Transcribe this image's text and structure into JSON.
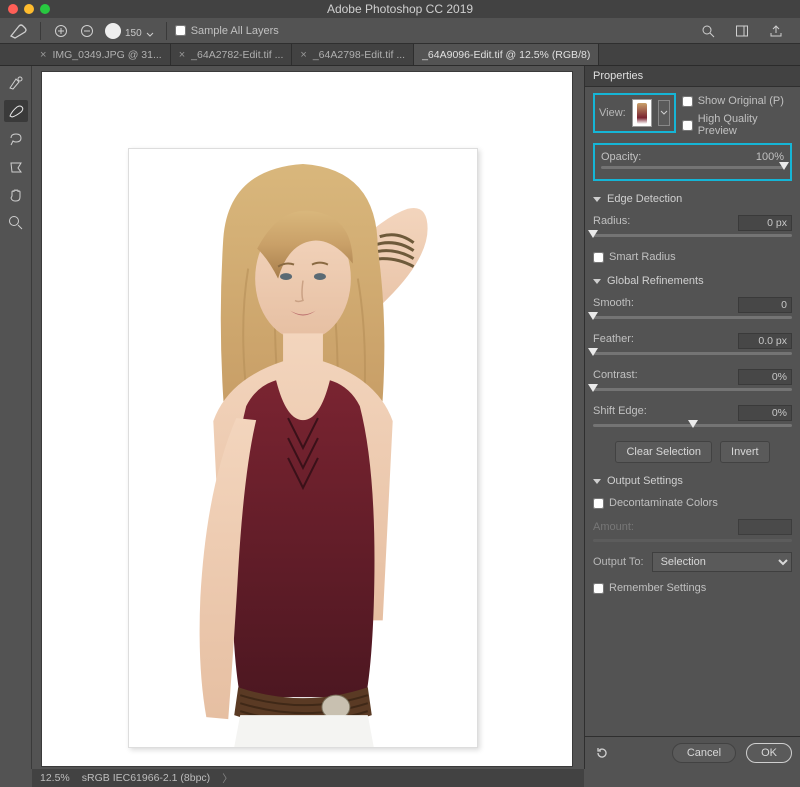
{
  "accent_color": "#15b5d6",
  "titlebar": {
    "title": "Adobe Photoshop CC 2019"
  },
  "optionsbar": {
    "brush_size": "150",
    "sample_all_layers_label": "Sample All Layers"
  },
  "tabs": [
    {
      "label": "IMG_0349.JPG @ 31...",
      "active": false
    },
    {
      "label": "_64A2782-Edit.tif ...",
      "active": false
    },
    {
      "label": "_64A2798-Edit.tif ...",
      "active": false
    },
    {
      "label": "_64A9096-Edit.tif @ 12.5% (RGB/8)",
      "active": true
    }
  ],
  "panel": {
    "header": "Properties",
    "view_label": "View:",
    "show_original_label": "Show Original (P)",
    "hq_preview_label": "High Quality Preview",
    "opacity_label": "Opacity:",
    "opacity_value": "100%",
    "sections": {
      "edge": {
        "title": "Edge Detection",
        "radius_label": "Radius:",
        "radius_value": "0 px",
        "smart_radius_label": "Smart Radius"
      },
      "refine": {
        "title": "Global Refinements",
        "smooth_label": "Smooth:",
        "smooth_value": "0",
        "feather_label": "Feather:",
        "feather_value": "0.0 px",
        "contrast_label": "Contrast:",
        "contrast_value": "0%",
        "shift_label": "Shift Edge:",
        "shift_value": "0%",
        "clear_btn": "Clear Selection",
        "invert_btn": "Invert"
      },
      "output": {
        "title": "Output Settings",
        "decon_label": "Decontaminate Colors",
        "amount_label": "Amount:",
        "output_to_label": "Output To:",
        "output_to_value": "Selection",
        "remember_label": "Remember Settings"
      }
    },
    "footer": {
      "cancel": "Cancel",
      "ok": "OK"
    }
  },
  "status": {
    "zoom": "12.5%",
    "profile": "sRGB IEC61966-2.1 (8bpc)"
  },
  "toolstrip": [
    "lasso-tool",
    "brush-tool",
    "eraser-tool",
    "pen-tool",
    "hand-tool",
    "zoom-tool"
  ],
  "opt_icons": [
    "plus-circle-icon",
    "minus-circle-icon",
    "rotate-icon"
  ],
  "opt_right_icons": [
    "search-icon",
    "panels-icon",
    "share-icon"
  ]
}
